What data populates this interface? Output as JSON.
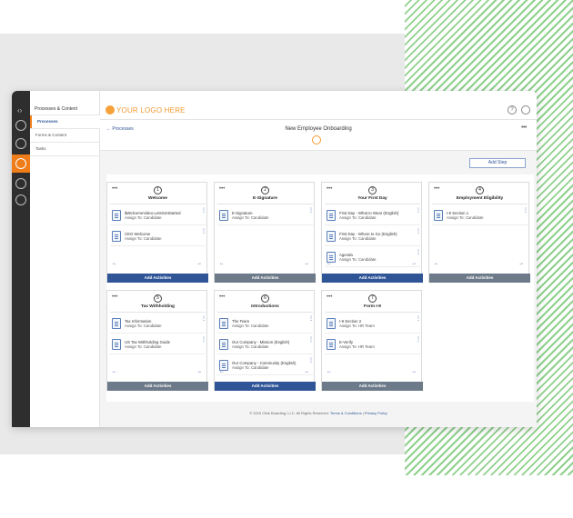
{
  "brand": {
    "logo_text": "YOUR LOGO HERE",
    "accent": "#ef7d1a",
    "primary": "#2f5597"
  },
  "nav": {
    "title": "Processes & Content",
    "items": [
      {
        "label": "Processes",
        "selected": true
      },
      {
        "label": "Forms & Content",
        "selected": false
      },
      {
        "label": "Tasks",
        "selected": false
      }
    ]
  },
  "topbar": {
    "help_icon": "?",
    "user_icon": "user-icon"
  },
  "subbar": {
    "back_label": "Processes",
    "back_arrow": "←",
    "page_title": "New Employee Onboarding"
  },
  "toolbar": {
    "add_step_label": "Add Step",
    "more": "•••"
  },
  "steps": [
    {
      "number": "1",
      "title": "Welcome",
      "button_style": "blue",
      "activities": [
        {
          "name": "$WelcomeVideo-LetsGetStarted",
          "assign": "Assign To: Candidate"
        },
        {
          "name": "CEO Welcome",
          "assign": "Assign To: Candidate"
        }
      ]
    },
    {
      "number": "2",
      "title": "E-Signature",
      "button_style": "gray",
      "activities": [
        {
          "name": "E-Signature",
          "assign": "Assign To: Candidate"
        }
      ]
    },
    {
      "number": "3",
      "title": "Your First Day",
      "button_style": "blue",
      "activities": [
        {
          "name": "First Day - What to Wear (English)",
          "assign": "Assign To: Candidate"
        },
        {
          "name": "First Day - Where to Go (English)",
          "assign": "Assign To: Candidate"
        },
        {
          "name": "Agenda",
          "assign": "Assign To: Candidate"
        }
      ]
    },
    {
      "number": "4",
      "title": "Employment Eligibility",
      "button_style": "gray",
      "activities": [
        {
          "name": "I-9 Section 1",
          "assign": "Assign To: Candidate"
        }
      ]
    },
    {
      "number": "5",
      "title": "Tax Withholding",
      "button_style": "gray",
      "activities": [
        {
          "name": "Tax Information",
          "assign": "Assign To: Candidate"
        },
        {
          "name": "US Tax Withholding Guide",
          "assign": "Assign To: Candidate"
        }
      ]
    },
    {
      "number": "6",
      "title": "Introductions",
      "button_style": "blue",
      "activities": [
        {
          "name": "The Team",
          "assign": "Assign To: Candidate"
        },
        {
          "name": "Our Company - Mission (English)",
          "assign": "Assign To: Candidate"
        },
        {
          "name": "Our Company - Community (English)",
          "assign": "Assign To: Candidate"
        }
      ]
    },
    {
      "number": "7",
      "title": "Form I-9",
      "button_style": "gray",
      "activities": [
        {
          "name": "I-9 Section 2",
          "assign": "Assign To: HR Team"
        },
        {
          "name": "E-Verify",
          "assign": "Assign To: HR Team"
        }
      ]
    }
  ],
  "add_activities_label": "Add Activities",
  "footer": {
    "copyright": "© 2019 Click Boarding, LLC. All Rights Reserved.",
    "terms": "Terms & Conditions",
    "divider": "|",
    "privacy": "Privacy Policy"
  }
}
